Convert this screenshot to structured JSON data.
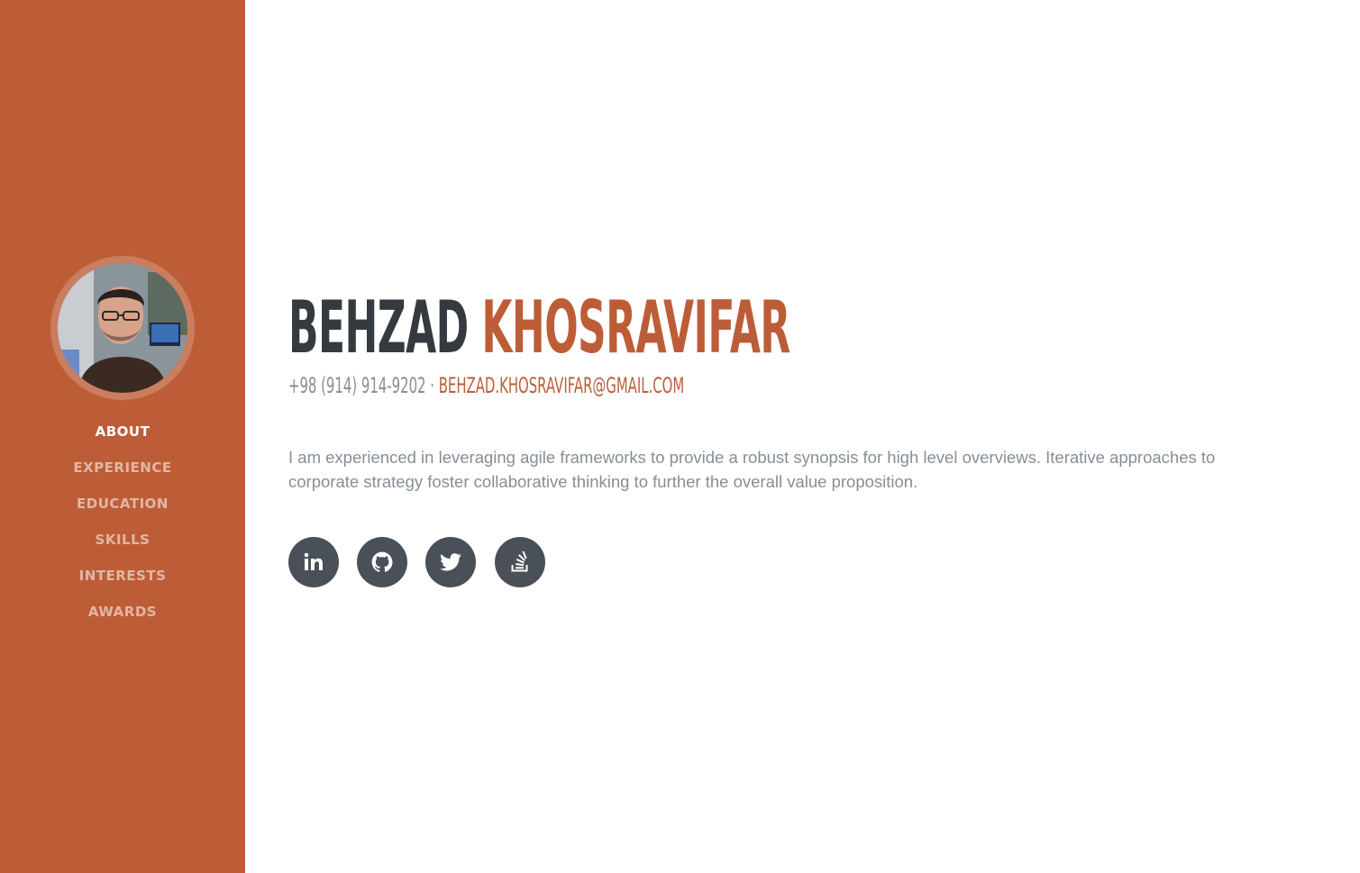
{
  "profile": {
    "first_name": "BEHZAD",
    "last_name": "KHOSRAVIFAR",
    "phone": "+98 (914) 914-9202 ·",
    "email": "BEHZAD.KHOSRAVIFAR@GMAIL.COM",
    "summary": "I am experienced in leveraging agile frameworks to provide a robust synopsis for high level overviews. Iterative approaches to corporate strategy foster collaborative thinking to further the overall value proposition."
  },
  "nav": {
    "items": [
      {
        "label": "ABOUT",
        "active": true
      },
      {
        "label": "EXPERIENCE",
        "active": false
      },
      {
        "label": "EDUCATION",
        "active": false
      },
      {
        "label": "SKILLS",
        "active": false
      },
      {
        "label": "INTERESTS",
        "active": false
      },
      {
        "label": "AWARDS",
        "active": false
      }
    ]
  },
  "social": [
    {
      "icon": "linkedin-icon"
    },
    {
      "icon": "github-icon"
    },
    {
      "icon": "twitter-icon"
    },
    {
      "icon": "stack-overflow-icon"
    }
  ],
  "colors": {
    "accent": "#bd5d38",
    "dark": "#343a40",
    "muted": "#868e96",
    "social_bg": "#495057"
  }
}
